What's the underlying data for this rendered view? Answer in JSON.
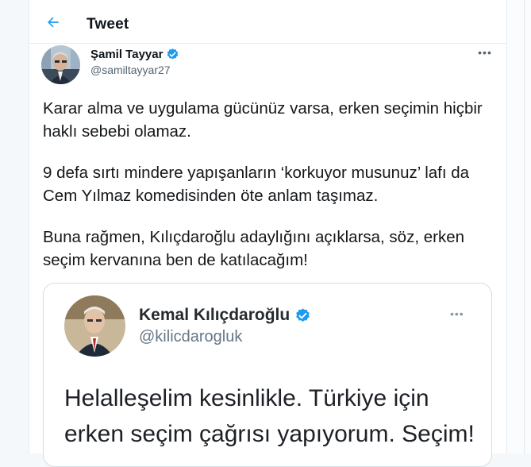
{
  "header": {
    "title": "Tweet",
    "back_icon": "arrow-left-icon"
  },
  "tweet": {
    "author": {
      "name": "Şamil Tayyar",
      "handle": "@samiltayyar27",
      "verified": true
    },
    "paragraphs": [
      "Karar alma ve uygulama gücünüz varsa, erken seçimin hiçbir haklı sebebi olamaz.",
      "9 defa sırtı mindere yapışanların ‘korkuyor musunuz’ lafı da Cem Yılmaz komedisinden öte anlam taşımaz.",
      "Buna rağmen, Kılıçdaroğlu adaylığını açıklarsa, söz, erken seçim kervanına ben de katılacağım!"
    ]
  },
  "quoted": {
    "author": {
      "name": "Kemal Kılıçdaroğlu",
      "handle": "@kilicdarogluk",
      "verified": true
    },
    "lines": [
      "Helalleşelim kesinlikle. Türkiye için",
      "erken seçim çağrısı yapıyorum. Seçim!"
    ]
  },
  "colors": {
    "accent": "#1d9bf0",
    "verified": "#1d9bf0",
    "muted": "#536471",
    "border": "#e6ecf0"
  }
}
